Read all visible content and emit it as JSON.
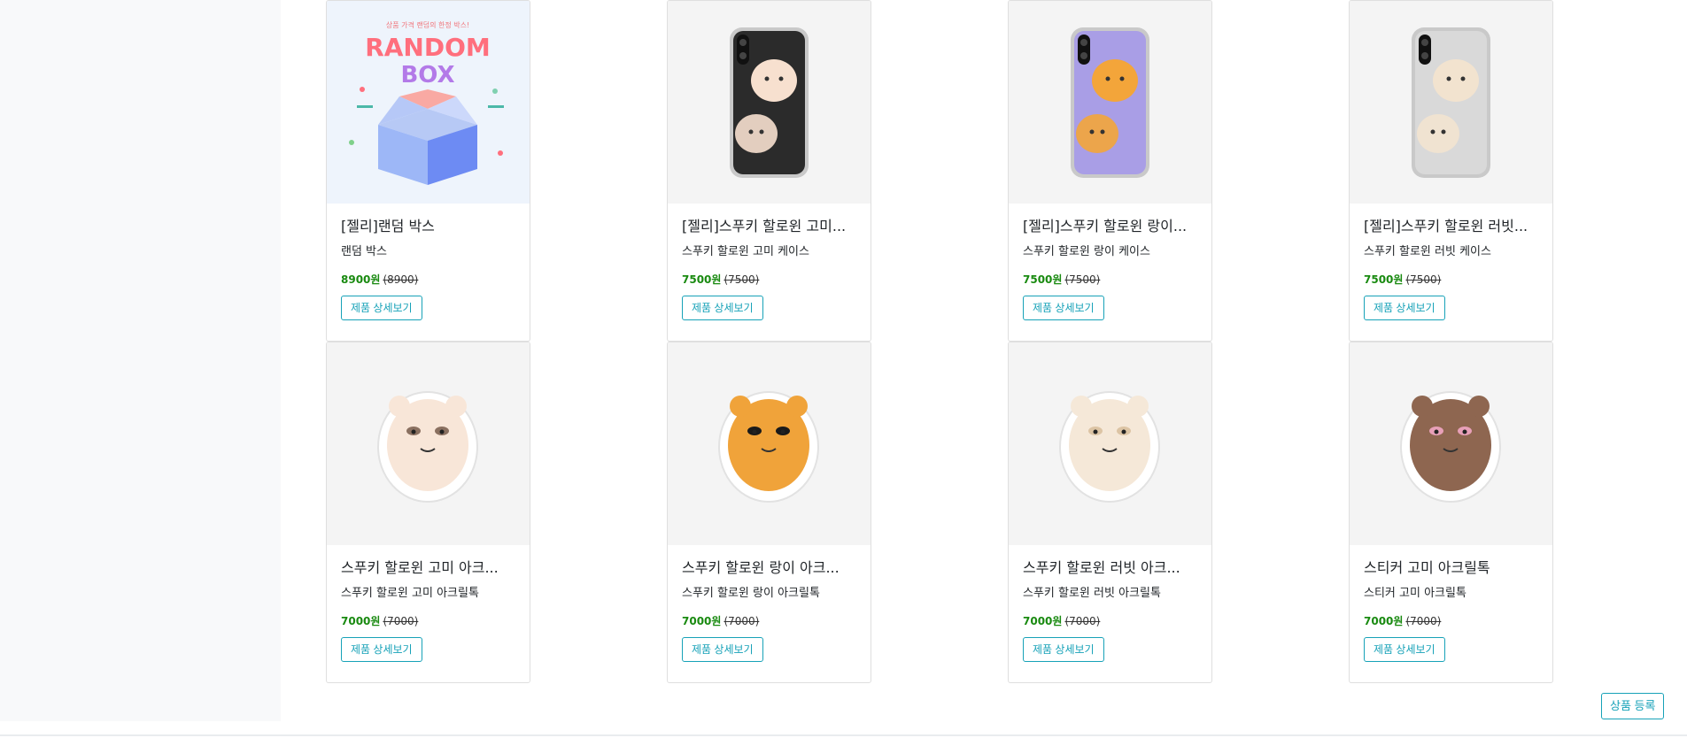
{
  "products": [
    {
      "title": "[젤리]랜덤 박스",
      "desc": "랜덤 박스",
      "price": "8900원",
      "orig": "(8900)",
      "button": "제품 상세보기",
      "art": {
        "type": "box",
        "top_text": "상품 가격 랜덤의 한정 박스!",
        "word1": "RANDOM",
        "word2": "BOX"
      }
    },
    {
      "title": "[젤리]스푸키 할로윈 고미...",
      "desc": "스푸키 할로윈 고미 케이스",
      "price": "7500원",
      "orig": "(7500)",
      "button": "제품 상세보기",
      "art": {
        "type": "phone",
        "screen": "#2b2b2b",
        "accent": "#f7e0cf"
      }
    },
    {
      "title": "[젤리]스푸키 할로윈 랑이...",
      "desc": "스푸키 할로윈 랑이 케이스",
      "price": "7500원",
      "orig": "(7500)",
      "button": "제품 상세보기",
      "art": {
        "type": "phone",
        "screen": "#a99ee6",
        "accent": "#f3a53a"
      }
    },
    {
      "title": "[젤리]스푸키 할로윈 러빗...",
      "desc": "스푸키 할로윈 러빗 케이스",
      "price": "7500원",
      "orig": "(7500)",
      "button": "제품 상세보기",
      "art": {
        "type": "phone",
        "screen": "#d9d9d9",
        "accent": "#f2e3cf"
      }
    },
    {
      "title": "스푸키 할로윈 고미 아크...",
      "desc": "스푸키 할로윈 고미 아크릴톡",
      "price": "7000원",
      "orig": "(7000)",
      "button": "제품 상세보기",
      "art": {
        "type": "char",
        "body": "#f8e6d8",
        "detail": "#8a7060"
      }
    },
    {
      "title": "스푸키 할로윈 랑이 아크...",
      "desc": "스푸키 할로윈 랑이 아크릴톡",
      "price": "7000원",
      "orig": "(7000)",
      "button": "제품 상세보기",
      "art": {
        "type": "char",
        "body": "#f0a33a",
        "detail": "#1a1a1a"
      }
    },
    {
      "title": "스푸키 할로윈 러빗 아크...",
      "desc": "스푸키 할로윈 러빗 아크릴톡",
      "price": "7000원",
      "orig": "(7000)",
      "button": "제품 상세보기",
      "art": {
        "type": "char",
        "body": "#f5e8d8",
        "detail": "#dcc4a4"
      }
    },
    {
      "title": "스티커 고미 아크릴톡",
      "desc": "스티커 고미 아크릴톡",
      "price": "7000원",
      "orig": "(7000)",
      "button": "제품 상세보기",
      "art": {
        "type": "char",
        "body": "#8e6650",
        "detail": "#e8a0b8"
      }
    }
  ],
  "register_button": "상품 등록"
}
